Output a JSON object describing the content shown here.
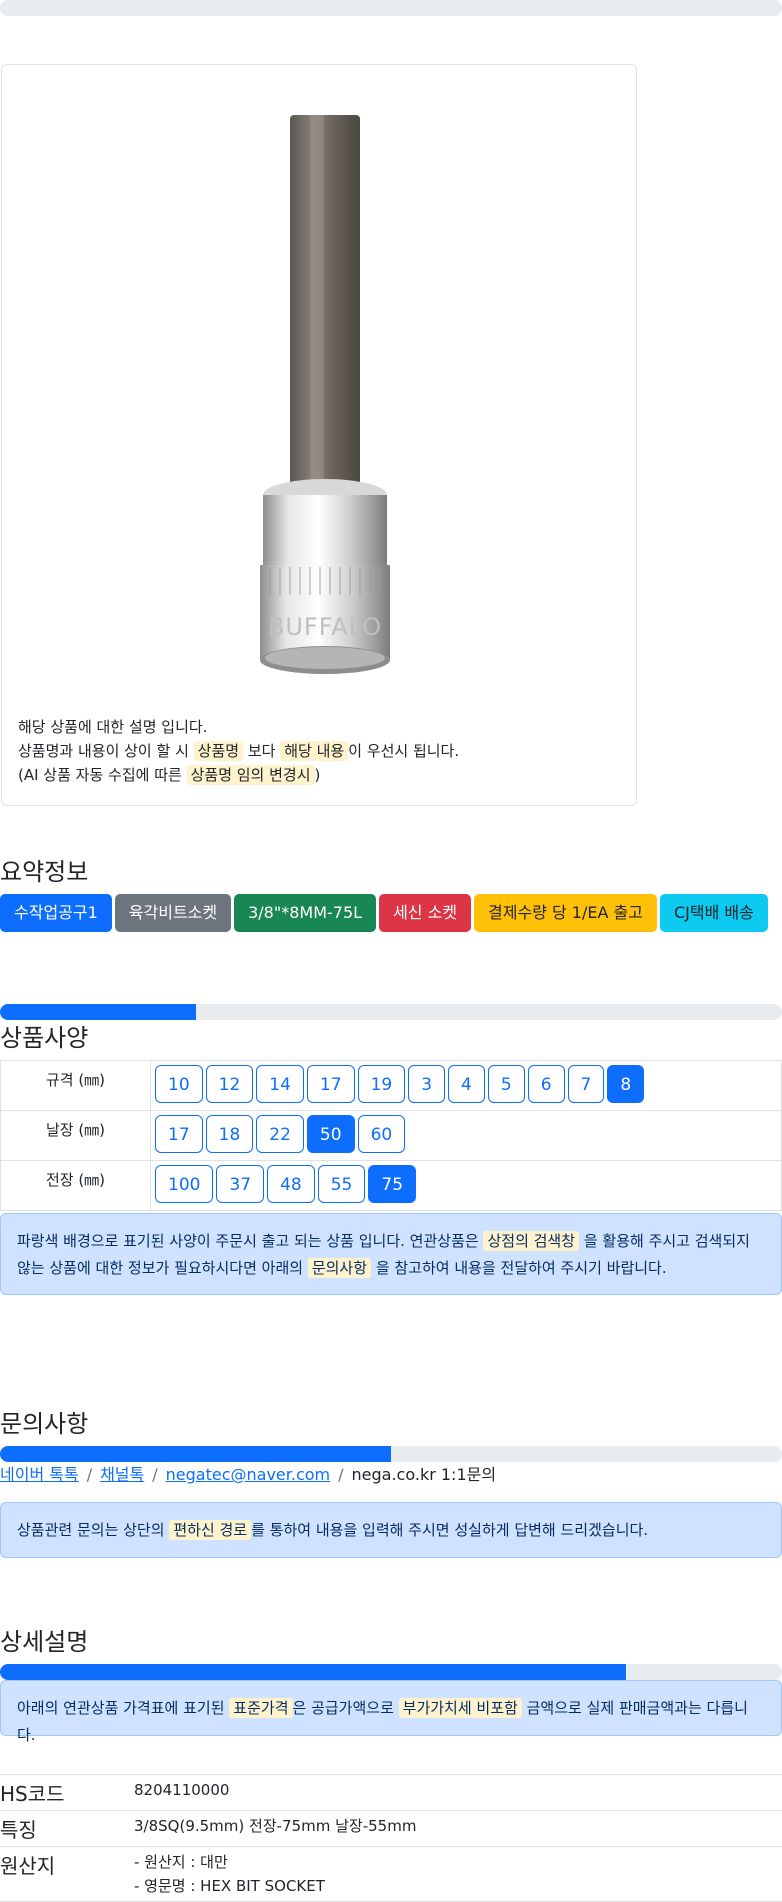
{
  "image_card": {
    "product_alt": "BUFFALO hex bit socket",
    "engraving": "BUFFALO",
    "desc_line1": "해당 상품에 대한 설명 입니다.",
    "desc_line2_a": "상품명과 내용이 상이 할 시",
    "desc_line2_mark1": "상품명",
    "desc_line2_b": "보다",
    "desc_line2_mark2": "해당 내용",
    "desc_line2_c": "이 우선시 됩니다.",
    "desc_line3_a": "(AI 상품 자동 수집에 따른",
    "desc_line3_mark": "상품명 임의 변경시",
    "desc_line3_b": ")"
  },
  "summary": {
    "title": "요약정보",
    "badges": [
      {
        "label": "수작업공구1",
        "color": "#0d6efd"
      },
      {
        "label": "육각비트소켓",
        "color": "#6c757d"
      },
      {
        "label": "3/8\"*8MM-75L",
        "color": "#198754"
      },
      {
        "label": "세신 소켓",
        "color": "#dc3545"
      },
      {
        "label": "결제수량 당 1/EA 출고",
        "color": "#ffc107"
      },
      {
        "label": "CJ택배 배송",
        "color": "#0dcaf0"
      }
    ]
  },
  "spec": {
    "title": "상품사양",
    "progress": 0.25,
    "rows": [
      {
        "label": "규격 (㎜)",
        "values": [
          "10",
          "12",
          "14",
          "17",
          "19",
          "3",
          "4",
          "5",
          "6",
          "7",
          "8"
        ],
        "active": "8"
      },
      {
        "label": "날장 (㎜)",
        "values": [
          "17",
          "18",
          "22",
          "50",
          "60"
        ],
        "active": "50"
      },
      {
        "label": "전장 (㎜)",
        "values": [
          "100",
          "37",
          "48",
          "55",
          "75"
        ],
        "active": "75"
      }
    ],
    "notice_a": "파랑색 배경으로 표기된 사양이 주문시 출고 되는 상품 입니다. 연관상품은",
    "notice_mark1": "상점의 검색창",
    "notice_b": "을 활용해 주시고 검색되지 않는 상품에 대한 정보가 필요하시다면 아래의",
    "notice_mark2": "문의사항",
    "notice_c": "을 참고하여 내용을 전달하여 주시기 바랍니다."
  },
  "inquiry": {
    "title": "문의사항",
    "progress": 0.5,
    "links": [
      "네이버 톡톡",
      "채널톡",
      "negatec@naver.com"
    ],
    "last": "nega.co.kr 1:1문의",
    "notice_a": "상품관련 문의는 상단의",
    "notice_mark": "편하신 경로",
    "notice_b": "를 통하여 내용을 입력해 주시면 성실하게 답변해 드리겠습니다."
  },
  "detail": {
    "title": "상세설명",
    "progress": 0.8,
    "notice_a": "아래의 연관상품 가격표에 표기된",
    "notice_mark1": "표준가격",
    "notice_b": "은 공급가액으로",
    "notice_mark2": "부가가치세 비포함",
    "notice_c": "금액으로 실제 판매금액과는 다릅니다."
  },
  "info_table": {
    "hs_key": "HS코드",
    "hs_val": "8204110000",
    "feature_key": "특징",
    "feature_val": "3/8SQ(9.5mm) 전장-75mm 날장-55mm",
    "origin_key": "원산지",
    "origin_val1": "- 원산지 : 대만",
    "origin_val2": "- 영문명 : HEX BIT SOCKET"
  }
}
